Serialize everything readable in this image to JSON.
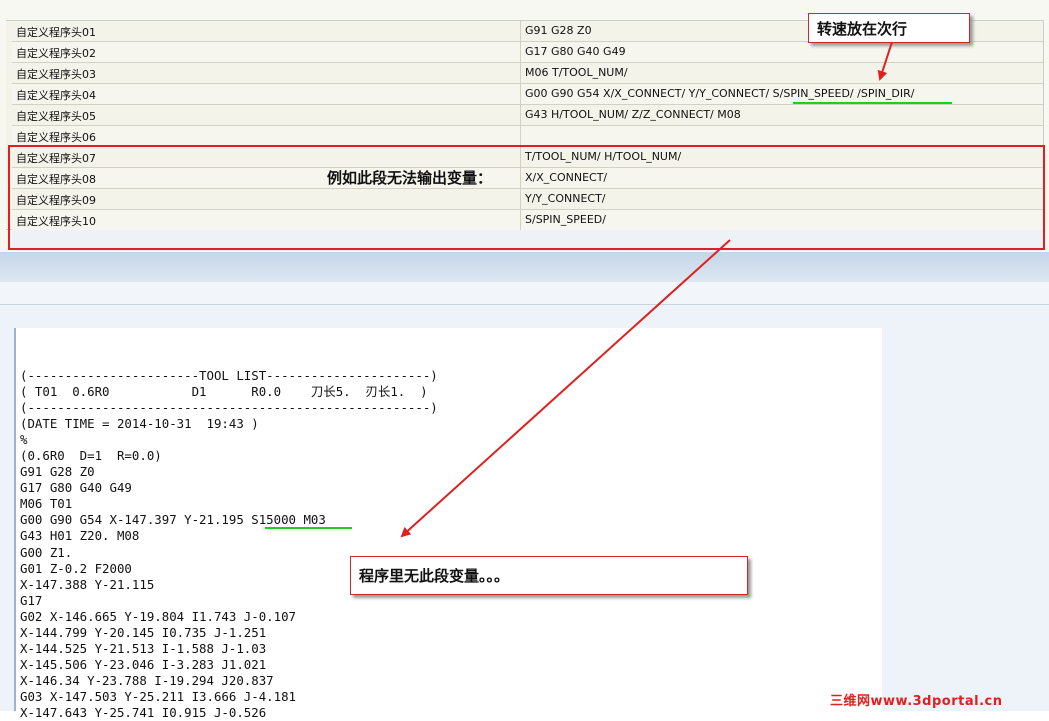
{
  "grid": {
    "rows": [
      {
        "name": "自定义程序头01",
        "value": "G91 G28 Z0"
      },
      {
        "name": "自定义程序头02",
        "value": "G17 G80 G40 G49"
      },
      {
        "name": "自定义程序头03",
        "value": "M06 T/TOOL_NUM/"
      },
      {
        "name": "自定义程序头04",
        "value": "G00 G90 G54 X/X_CONNECT/ Y/Y_CONNECT/ S/SPIN_SPEED/ /SPIN_DIR/"
      },
      {
        "name": "自定义程序头05",
        "value": "G43 H/TOOL_NUM/ Z/Z_CONNECT/ M08"
      },
      {
        "name": "自定义程序头06",
        "value": ""
      },
      {
        "name": "自定义程序头07",
        "value": "T/TOOL_NUM/   H/TOOL_NUM/"
      },
      {
        "name": "自定义程序头08",
        "value": "X/X_CONNECT/"
      },
      {
        "name": "自定义程序头09",
        "value": "Y/Y_CONNECT/"
      },
      {
        "name": "自定义程序头10",
        "value": "S/SPIN_SPEED/"
      }
    ]
  },
  "annotations": {
    "spindle_note": "转速放在次行",
    "no_output_note": "例如此段无法输出变量：",
    "missing_note": "程序里无此段变量。。。"
  },
  "code": {
    "lines": [
      "(-----------------------TOOL LIST----------------------)",
      "( T01  0.6R0           D1      R0.0    刀长5.  刃长1.  )",
      "(------------------------------------------------------)",
      "(DATE TIME = 2014-10-31  19:43 )",
      "%",
      "(0.6R0  D=1  R=0.0)",
      "G91 G28 Z0",
      "G17 G80 G40 G49",
      "M06 T01",
      "G00 G90 G54 X-147.397 Y-21.195 S15000 M03",
      "G43 H01 Z20. M08",
      "G00 Z1.",
      "G01 Z-0.2 F2000",
      "X-147.388 Y-21.115",
      "G17",
      "G02 X-146.665 Y-19.804 I1.743 J-0.107",
      "X-144.799 Y-20.145 I0.735 J-1.251",
      "X-144.525 Y-21.513 I-1.588 J-1.03",
      "X-145.506 Y-23.046 I-3.283 J1.021",
      "X-146.34 Y-23.788 I-19.294 J20.837",
      "G03 X-147.503 Y-25.211 I3.666 J-4.181",
      "X-147.643 Y-25.741 I0.915 J-0.526"
    ]
  },
  "watermark": "三维网www.3dportal.cn",
  "colors": {
    "annotation_red": "#e02020",
    "underline_green": "#22cc22",
    "panel_blue": "#c5d6e8"
  }
}
